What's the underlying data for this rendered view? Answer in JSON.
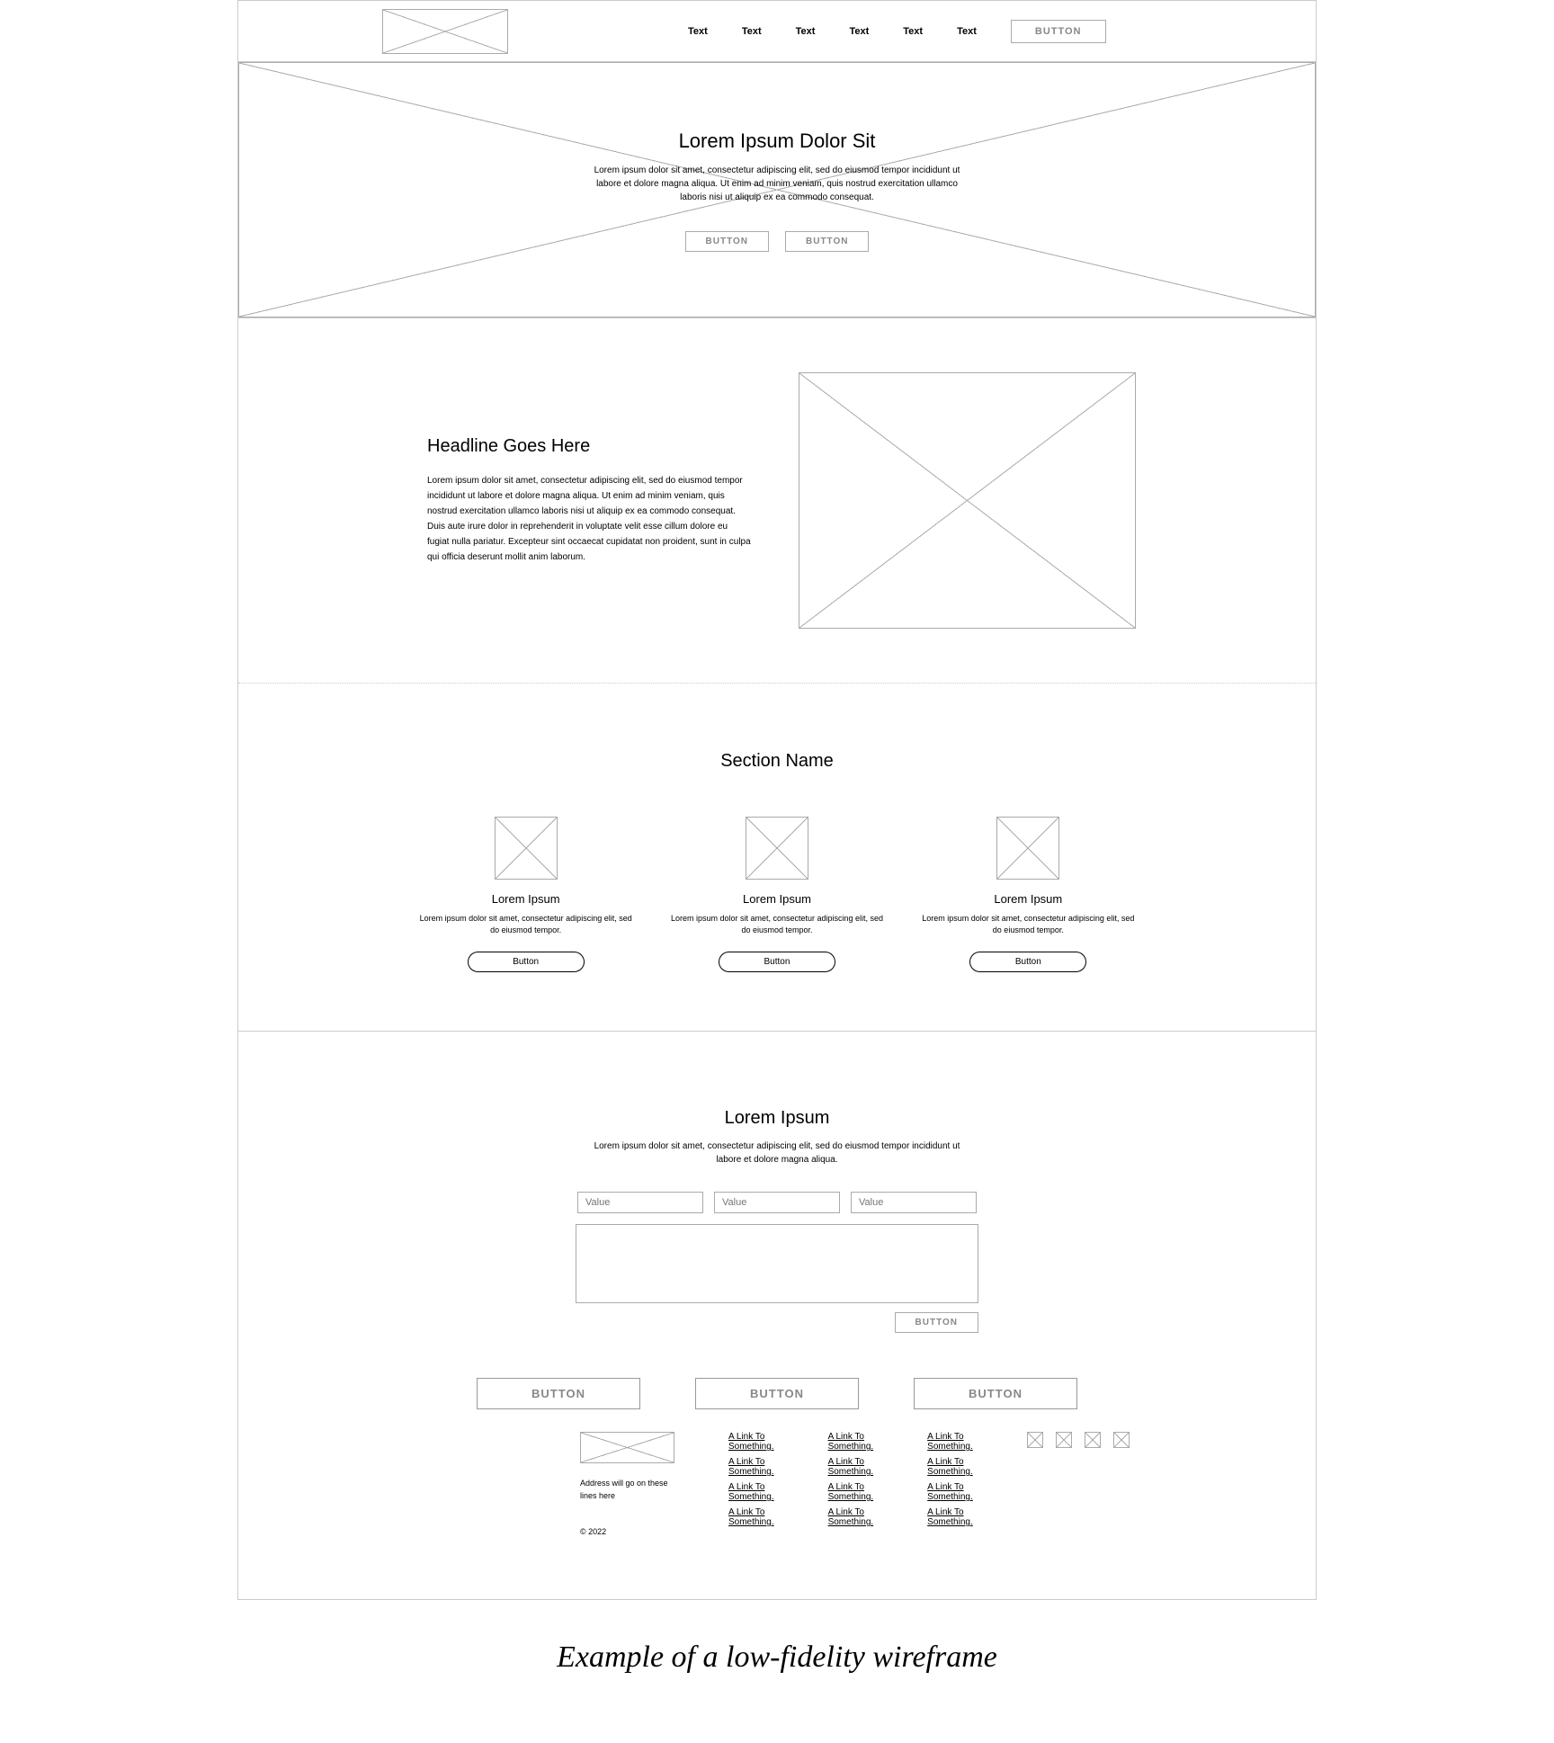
{
  "header": {
    "nav": [
      "Text",
      "Text",
      "Text",
      "Text",
      "Text",
      "Text"
    ],
    "button": "BUTTON"
  },
  "hero": {
    "title": "Lorem Ipsum Dolor Sit",
    "body": "Lorem ipsum dolor sit amet, consectetur adipiscing elit, sed do eiusmod tempor incididunt ut labore et dolore magna aliqua. Ut enim ad minim veniam, quis nostrud exercitation ullamco laboris nisi ut aliquip ex ea commodo consequat.",
    "buttons": [
      "BUTTON",
      "BUTTON"
    ]
  },
  "twocol": {
    "headline": "Headline Goes Here",
    "body": "Lorem ipsum dolor sit amet, consectetur adipiscing elit, sed do eiusmod tempor incididunt ut labore et dolore magna aliqua. Ut enim ad minim veniam, quis nostrud exercitation ullamco laboris nisi ut aliquip ex ea commodo consequat. Duis aute irure dolor in reprehenderit in voluptate velit esse cillum dolore eu fugiat nulla pariatur. Excepteur sint occaecat cupidatat non proident, sunt in culpa qui officia deserunt mollit anim laborum."
  },
  "grid": {
    "title": "Section Name",
    "cards": [
      {
        "title": "Lorem Ipsum",
        "body": "Lorem ipsum dolor sit amet, consectetur adipiscing elit, sed do eiusmod tempor.",
        "button": "Button"
      },
      {
        "title": "Lorem Ipsum",
        "body": "Lorem ipsum dolor sit amet, consectetur adipiscing elit, sed do eiusmod tempor.",
        "button": "Button"
      },
      {
        "title": "Lorem Ipsum",
        "body": "Lorem ipsum dolor sit amet, consectetur adipiscing elit, sed do eiusmod tempor.",
        "button": "Button"
      }
    ]
  },
  "form": {
    "title": "Lorem Ipsum",
    "body": "Lorem ipsum dolor sit amet, consectetur adipiscing elit, sed do eiusmod tempor incididunt ut labore et dolore magna aliqua.",
    "placeholders": [
      "Value",
      "Value",
      "Value"
    ],
    "submit": "BUTTON"
  },
  "cta": [
    "BUTTON",
    "BUTTON",
    "BUTTON"
  ],
  "footer": {
    "address": "Address will go on these lines here",
    "copy": "© 2022",
    "cols": [
      [
        "A Link To Something.",
        "A Link To Something.",
        "A Link To Something.",
        "A Link To Something."
      ],
      [
        "A Link To Something.",
        "A Link To Something.",
        "A Link To Something.",
        "A Link To Something."
      ],
      [
        "A Link To Something.",
        "A Link To Something.",
        "A Link To Something.",
        "A Link To Something."
      ]
    ]
  },
  "caption": "Example of a low-fidelity wireframe"
}
